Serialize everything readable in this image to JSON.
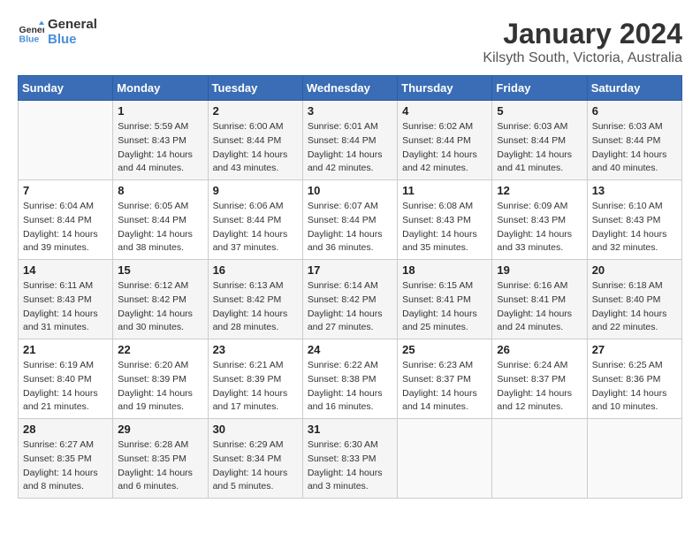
{
  "logo": {
    "text_general": "General",
    "text_blue": "Blue"
  },
  "title": "January 2024",
  "subtitle": "Kilsyth South, Victoria, Australia",
  "weekdays": [
    "Sunday",
    "Monday",
    "Tuesday",
    "Wednesday",
    "Thursday",
    "Friday",
    "Saturday"
  ],
  "weeks": [
    [
      {
        "day": "",
        "sunrise": "",
        "sunset": "",
        "daylight": ""
      },
      {
        "day": "1",
        "sunrise": "Sunrise: 5:59 AM",
        "sunset": "Sunset: 8:43 PM",
        "daylight": "Daylight: 14 hours and 44 minutes."
      },
      {
        "day": "2",
        "sunrise": "Sunrise: 6:00 AM",
        "sunset": "Sunset: 8:44 PM",
        "daylight": "Daylight: 14 hours and 43 minutes."
      },
      {
        "day": "3",
        "sunrise": "Sunrise: 6:01 AM",
        "sunset": "Sunset: 8:44 PM",
        "daylight": "Daylight: 14 hours and 42 minutes."
      },
      {
        "day": "4",
        "sunrise": "Sunrise: 6:02 AM",
        "sunset": "Sunset: 8:44 PM",
        "daylight": "Daylight: 14 hours and 42 minutes."
      },
      {
        "day": "5",
        "sunrise": "Sunrise: 6:03 AM",
        "sunset": "Sunset: 8:44 PM",
        "daylight": "Daylight: 14 hours and 41 minutes."
      },
      {
        "day": "6",
        "sunrise": "Sunrise: 6:03 AM",
        "sunset": "Sunset: 8:44 PM",
        "daylight": "Daylight: 14 hours and 40 minutes."
      }
    ],
    [
      {
        "day": "7",
        "sunrise": "Sunrise: 6:04 AM",
        "sunset": "Sunset: 8:44 PM",
        "daylight": "Daylight: 14 hours and 39 minutes."
      },
      {
        "day": "8",
        "sunrise": "Sunrise: 6:05 AM",
        "sunset": "Sunset: 8:44 PM",
        "daylight": "Daylight: 14 hours and 38 minutes."
      },
      {
        "day": "9",
        "sunrise": "Sunrise: 6:06 AM",
        "sunset": "Sunset: 8:44 PM",
        "daylight": "Daylight: 14 hours and 37 minutes."
      },
      {
        "day": "10",
        "sunrise": "Sunrise: 6:07 AM",
        "sunset": "Sunset: 8:44 PM",
        "daylight": "Daylight: 14 hours and 36 minutes."
      },
      {
        "day": "11",
        "sunrise": "Sunrise: 6:08 AM",
        "sunset": "Sunset: 8:43 PM",
        "daylight": "Daylight: 14 hours and 35 minutes."
      },
      {
        "day": "12",
        "sunrise": "Sunrise: 6:09 AM",
        "sunset": "Sunset: 8:43 PM",
        "daylight": "Daylight: 14 hours and 33 minutes."
      },
      {
        "day": "13",
        "sunrise": "Sunrise: 6:10 AM",
        "sunset": "Sunset: 8:43 PM",
        "daylight": "Daylight: 14 hours and 32 minutes."
      }
    ],
    [
      {
        "day": "14",
        "sunrise": "Sunrise: 6:11 AM",
        "sunset": "Sunset: 8:43 PM",
        "daylight": "Daylight: 14 hours and 31 minutes."
      },
      {
        "day": "15",
        "sunrise": "Sunrise: 6:12 AM",
        "sunset": "Sunset: 8:42 PM",
        "daylight": "Daylight: 14 hours and 30 minutes."
      },
      {
        "day": "16",
        "sunrise": "Sunrise: 6:13 AM",
        "sunset": "Sunset: 8:42 PM",
        "daylight": "Daylight: 14 hours and 28 minutes."
      },
      {
        "day": "17",
        "sunrise": "Sunrise: 6:14 AM",
        "sunset": "Sunset: 8:42 PM",
        "daylight": "Daylight: 14 hours and 27 minutes."
      },
      {
        "day": "18",
        "sunrise": "Sunrise: 6:15 AM",
        "sunset": "Sunset: 8:41 PM",
        "daylight": "Daylight: 14 hours and 25 minutes."
      },
      {
        "day": "19",
        "sunrise": "Sunrise: 6:16 AM",
        "sunset": "Sunset: 8:41 PM",
        "daylight": "Daylight: 14 hours and 24 minutes."
      },
      {
        "day": "20",
        "sunrise": "Sunrise: 6:18 AM",
        "sunset": "Sunset: 8:40 PM",
        "daylight": "Daylight: 14 hours and 22 minutes."
      }
    ],
    [
      {
        "day": "21",
        "sunrise": "Sunrise: 6:19 AM",
        "sunset": "Sunset: 8:40 PM",
        "daylight": "Daylight: 14 hours and 21 minutes."
      },
      {
        "day": "22",
        "sunrise": "Sunrise: 6:20 AM",
        "sunset": "Sunset: 8:39 PM",
        "daylight": "Daylight: 14 hours and 19 minutes."
      },
      {
        "day": "23",
        "sunrise": "Sunrise: 6:21 AM",
        "sunset": "Sunset: 8:39 PM",
        "daylight": "Daylight: 14 hours and 17 minutes."
      },
      {
        "day": "24",
        "sunrise": "Sunrise: 6:22 AM",
        "sunset": "Sunset: 8:38 PM",
        "daylight": "Daylight: 14 hours and 16 minutes."
      },
      {
        "day": "25",
        "sunrise": "Sunrise: 6:23 AM",
        "sunset": "Sunset: 8:37 PM",
        "daylight": "Daylight: 14 hours and 14 minutes."
      },
      {
        "day": "26",
        "sunrise": "Sunrise: 6:24 AM",
        "sunset": "Sunset: 8:37 PM",
        "daylight": "Daylight: 14 hours and 12 minutes."
      },
      {
        "day": "27",
        "sunrise": "Sunrise: 6:25 AM",
        "sunset": "Sunset: 8:36 PM",
        "daylight": "Daylight: 14 hours and 10 minutes."
      }
    ],
    [
      {
        "day": "28",
        "sunrise": "Sunrise: 6:27 AM",
        "sunset": "Sunset: 8:35 PM",
        "daylight": "Daylight: 14 hours and 8 minutes."
      },
      {
        "day": "29",
        "sunrise": "Sunrise: 6:28 AM",
        "sunset": "Sunset: 8:35 PM",
        "daylight": "Daylight: 14 hours and 6 minutes."
      },
      {
        "day": "30",
        "sunrise": "Sunrise: 6:29 AM",
        "sunset": "Sunset: 8:34 PM",
        "daylight": "Daylight: 14 hours and 5 minutes."
      },
      {
        "day": "31",
        "sunrise": "Sunrise: 6:30 AM",
        "sunset": "Sunset: 8:33 PM",
        "daylight": "Daylight: 14 hours and 3 minutes."
      },
      {
        "day": "",
        "sunrise": "",
        "sunset": "",
        "daylight": ""
      },
      {
        "day": "",
        "sunrise": "",
        "sunset": "",
        "daylight": ""
      },
      {
        "day": "",
        "sunrise": "",
        "sunset": "",
        "daylight": ""
      }
    ]
  ]
}
